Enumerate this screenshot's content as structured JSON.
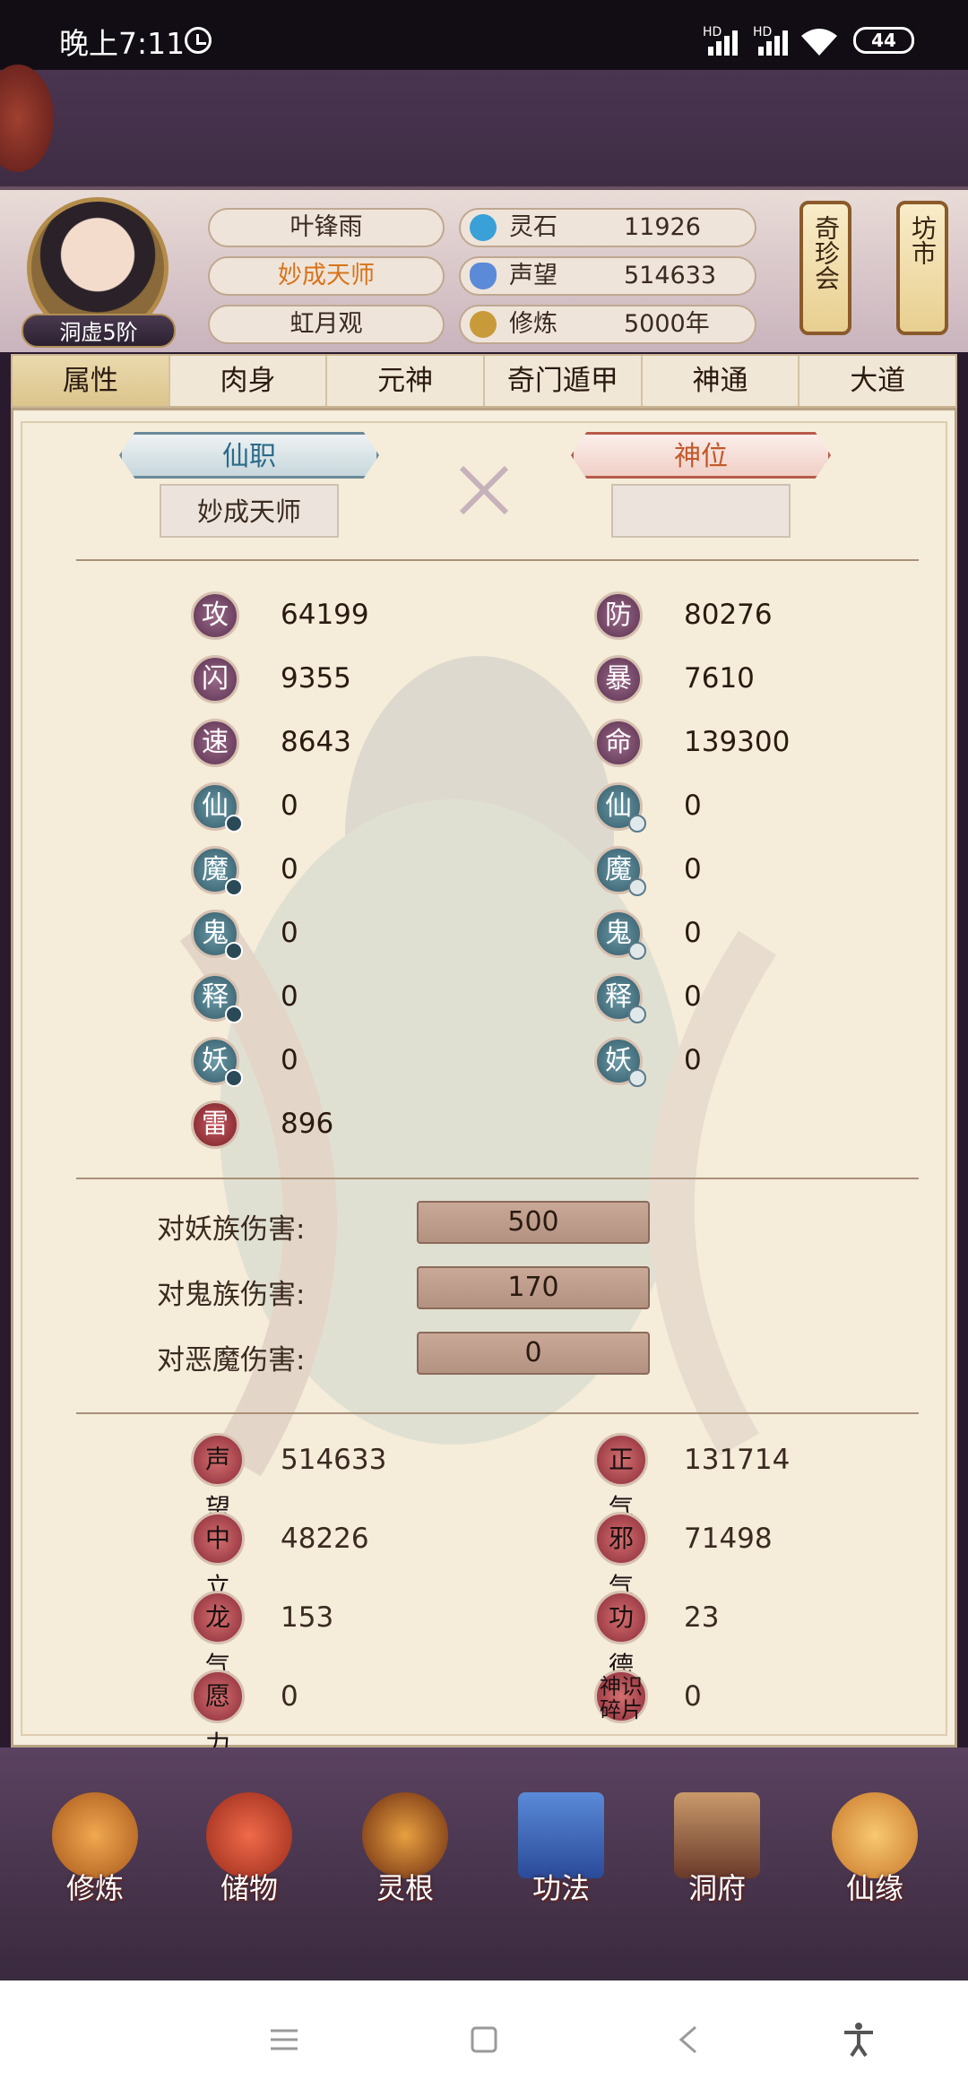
{
  "status_bar": {
    "time": "晚上7:11",
    "battery": "44",
    "net1": "HD",
    "net2": "HD"
  },
  "player": {
    "name": "叶锋雨",
    "title": "妙成天师",
    "sect": "虹月观",
    "rank": "洞虚5阶"
  },
  "resources": [
    {
      "label": "灵石",
      "value": "11926",
      "icon": "spirit-stone-icon",
      "color": "#3aa0d8"
    },
    {
      "label": "声望",
      "value": "514633",
      "icon": "reputation-crystal-icon",
      "color": "#5a8ad8"
    },
    {
      "label": "修炼",
      "value": "5000年",
      "icon": "meditating-figure-icon",
      "color": "#c89a3a"
    }
  ],
  "lanterns": {
    "market_hall": "奇珍会",
    "bazaar": "坊市"
  },
  "tabs": [
    "属性",
    "肉身",
    "元神",
    "奇门遁甲",
    "神通",
    "大道"
  ],
  "positions": {
    "immortal_post": "仙职",
    "immortal_post_value": "妙成天师",
    "divine_rank": "神位",
    "divine_rank_value": ""
  },
  "stats_left": [
    {
      "glyph": "攻",
      "value": "64199"
    },
    {
      "glyph": "闪",
      "value": "9355"
    },
    {
      "glyph": "速",
      "value": "8643"
    },
    {
      "glyph": "仙",
      "value": "0"
    },
    {
      "glyph": "魔",
      "value": "0"
    },
    {
      "glyph": "鬼",
      "value": "0"
    },
    {
      "glyph": "释",
      "value": "0"
    },
    {
      "glyph": "妖",
      "value": "0"
    },
    {
      "glyph": "雷",
      "value": "896"
    }
  ],
  "stats_right": [
    {
      "glyph": "防",
      "value": "80276"
    },
    {
      "glyph": "暴",
      "value": "7610"
    },
    {
      "glyph": "命",
      "value": "139300"
    },
    {
      "glyph": "仙",
      "value": "0"
    },
    {
      "glyph": "魔",
      "value": "0"
    },
    {
      "glyph": "鬼",
      "value": "0"
    },
    {
      "glyph": "释",
      "value": "0"
    },
    {
      "glyph": "妖",
      "value": "0"
    }
  ],
  "damage": [
    {
      "label": "对妖族伤害:",
      "value": "500"
    },
    {
      "label": "对鬼族伤害:",
      "value": "170"
    },
    {
      "label": "对恶魔伤害:",
      "value": "0"
    }
  ],
  "reputation_left": [
    {
      "glyph": "声望",
      "value": "514633"
    },
    {
      "glyph": "中立",
      "value": "48226"
    },
    {
      "glyph": "龙气",
      "value": "153"
    },
    {
      "glyph": "愿力",
      "value": "0"
    }
  ],
  "reputation_right": [
    {
      "glyph": "正气",
      "value": "131714"
    },
    {
      "glyph": "邪气",
      "value": "71498"
    },
    {
      "glyph": "功德",
      "value": "23"
    },
    {
      "glyph": "神识碎片",
      "value": "0"
    }
  ],
  "bottom_nav": [
    {
      "label": "修炼",
      "icon": "cultivate-monk-icon",
      "color": "#c8782a"
    },
    {
      "label": "储物",
      "icon": "storage-bag-icon",
      "color": "#c83a2a"
    },
    {
      "label": "灵根",
      "icon": "spirit-root-swirl-icon",
      "color": "#a85a1a"
    },
    {
      "label": "功法",
      "icon": "technique-book-icon",
      "color": "#3a6ab8"
    },
    {
      "label": "洞府",
      "icon": "cave-mansion-icon",
      "color": "#8a5a3a"
    },
    {
      "label": "仙缘",
      "icon": "gourd-yinyang-icon",
      "color": "#d88a3a"
    }
  ]
}
